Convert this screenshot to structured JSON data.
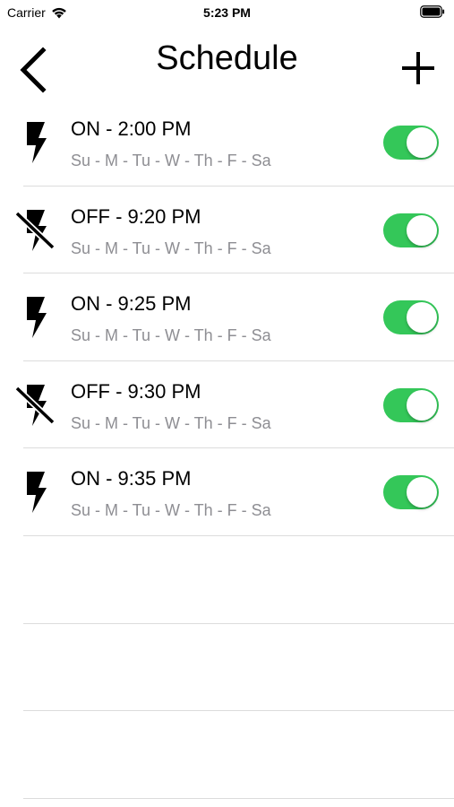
{
  "status_bar": {
    "carrier": "Carrier",
    "time": "5:23 PM",
    "wifi_icon": "wifi-icon",
    "battery_icon": "battery-icon"
  },
  "nav": {
    "title": "Schedule",
    "back_icon": "chevron-left-icon",
    "add_icon": "plus-icon"
  },
  "colors": {
    "toggle_on": "#34c759",
    "secondary_text": "#8e8e93",
    "separator": "#dcdcdc"
  },
  "schedules": [
    {
      "title": "ON - 2:00 PM",
      "days": "Su - M - Tu - W - Th - F - Sa",
      "icon": "flash-on-icon",
      "enabled": true
    },
    {
      "title": "OFF - 9:20 PM",
      "days": "Su - M - Tu - W - Th - F - Sa",
      "icon": "flash-off-icon",
      "enabled": true
    },
    {
      "title": "ON - 9:25 PM",
      "days": "Su - M - Tu - W - Th - F - Sa",
      "icon": "flash-on-icon",
      "enabled": true
    },
    {
      "title": "OFF - 9:30 PM",
      "days": "Su - M - Tu - W - Th - F - Sa",
      "icon": "flash-off-icon",
      "enabled": true
    },
    {
      "title": "ON - 9:35 PM",
      "days": "Su - M - Tu - W - Th - F - Sa",
      "icon": "flash-on-icon",
      "enabled": true
    }
  ]
}
